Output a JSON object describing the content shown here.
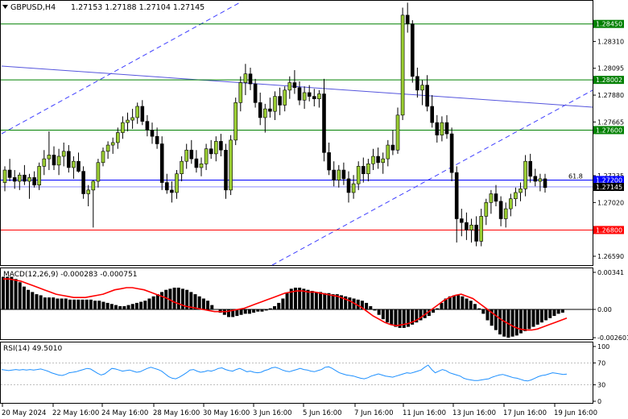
{
  "header": {
    "symbol": "GBPUSD,H4",
    "ohlc": "1.27153 1.27188 1.27104 1.27145",
    "triangle_icon": "triangle-down-icon"
  },
  "colors": {
    "bull": "#9acd32",
    "bear": "#000000",
    "green_line": "#008000",
    "blue_line": "#0000ff",
    "red_line": "#ff0000",
    "channel": "#4040ff",
    "trend": "#5555dd"
  },
  "price_axis": {
    "ticks": [
      "1.28310",
      "1.28095",
      "1.27880",
      "1.27665",
      "1.27235",
      "1.27020",
      "1.26590"
    ],
    "labels": [
      {
        "text": "1.28450",
        "value": 1.2845,
        "color": "#008000"
      },
      {
        "text": "1.28002",
        "value": 1.28002,
        "color": "#008000"
      },
      {
        "text": "1.27600",
        "value": 1.276,
        "color": "#008000"
      },
      {
        "text": "1.27200",
        "value": 1.272,
        "color": "#0000ff"
      },
      {
        "text": "1.27145",
        "value": 1.27145,
        "color": "#000000"
      },
      {
        "text": "1.26800",
        "value": 1.268,
        "color": "#ff0000"
      }
    ],
    "fib_label": "61.8"
  },
  "macd": {
    "label": "MACD(12,26,9) -0.000283 -0.000751",
    "ticks": [
      "0.00341",
      "0.00",
      "-0.002601"
    ],
    "hist": [
      0.003,
      0.003,
      0.003,
      0.0028,
      0.0025,
      0.0021,
      0.0018,
      0.0016,
      0.0014,
      0.0013,
      0.0011,
      0.0011,
      0.0011,
      0.001,
      0.001,
      0.001,
      0.0009,
      0.0009,
      0.0009,
      0.0009,
      0.0009,
      0.0009,
      0.0008,
      0.0008,
      0.0007,
      0.0006,
      0.0005,
      0.0004,
      0.0003,
      0.0003,
      0.0004,
      0.0005,
      0.0006,
      0.0007,
      0.0008,
      0.001,
      0.0012,
      0.0014,
      0.0016,
      0.0018,
      0.0019,
      0.002,
      0.002,
      0.0019,
      0.0018,
      0.0016,
      0.0014,
      0.0012,
      0.001,
      0.0008,
      0.0004,
      0.0,
      -0.0003,
      -0.0005,
      -0.0007,
      -0.0007,
      -0.0006,
      -0.0005,
      -0.0004,
      -0.0004,
      -0.0003,
      -0.0002,
      -0.0002,
      -0.0001,
      0.0001,
      0.0003,
      0.0006,
      0.001,
      0.0015,
      0.0019,
      0.002,
      0.002,
      0.0019,
      0.0018,
      0.0017,
      0.0016,
      0.0016,
      0.0015,
      0.0015,
      0.0014,
      0.0014,
      0.0013,
      0.0012,
      0.0011,
      0.001,
      0.0009,
      0.0008,
      0.0006,
      0.0003,
      -0.0001,
      -0.0005,
      -0.0009,
      -0.0012,
      -0.0014,
      -0.0016,
      -0.0017,
      -0.0017,
      -0.0016,
      -0.0014,
      -0.0012,
      -0.001,
      -0.0008,
      -0.0006,
      -0.0003,
      0.0001,
      0.0006,
      0.001,
      0.0012,
      0.0013,
      0.0013,
      0.0012,
      0.001,
      0.0008,
      0.0005,
      0.0001,
      -0.0004,
      -0.001,
      -0.0015,
      -0.0019,
      -0.0023,
      -0.0025,
      -0.0026,
      -0.0025,
      -0.0024,
      -0.0022,
      -0.002,
      -0.0018,
      -0.0016,
      -0.0014,
      -0.0012,
      -0.001,
      -0.0008,
      -0.0006,
      -0.0004,
      -0.0003
    ],
    "signal": [
      0.0028,
      0.0028,
      0.0027,
      0.0026,
      0.0024,
      0.0022,
      0.002,
      0.0018,
      0.0016,
      0.0014,
      0.0013,
      0.0012,
      0.0011,
      0.0011,
      0.0011,
      0.0012,
      0.0013,
      0.0014,
      0.0016,
      0.0018,
      0.0019,
      0.002,
      0.002,
      0.0019,
      0.0018,
      0.0016,
      0.0014,
      0.0012,
      0.001,
      0.0007,
      0.0005,
      0.0003,
      0.0002,
      0.0001,
      0.0,
      -0.0001,
      -0.0002,
      -0.0002,
      -0.0002,
      -0.0001,
      0.0,
      0.0001,
      0.0003,
      0.0005,
      0.0007,
      0.0009,
      0.0011,
      0.0013,
      0.0015,
      0.0016,
      0.0017,
      0.0017,
      0.0016,
      0.0016,
      0.0015,
      0.0014,
      0.0013,
      0.0012,
      0.001,
      0.0008,
      0.0005,
      0.0002,
      -0.0002,
      -0.0006,
      -0.0009,
      -0.0012,
      -0.0014,
      -0.0015,
      -0.0014,
      -0.0013,
      -0.0011,
      -0.0008,
      -0.0004,
      0.0,
      0.0004,
      0.0008,
      0.0011,
      0.0013,
      0.0014,
      0.0012,
      0.001,
      0.0006,
      0.0002,
      -0.0002,
      -0.0006,
      -0.001,
      -0.0013,
      -0.0016,
      -0.0018,
      -0.0019,
      -0.0019,
      -0.0018,
      -0.0016,
      -0.0014,
      -0.0012,
      -0.001,
      -0.0008
    ]
  },
  "rsi": {
    "label": "RSI(14) 49.5010",
    "ticks": [
      "100",
      "70",
      "30",
      "0"
    ],
    "values": [
      58,
      57,
      56,
      57,
      58,
      57,
      58,
      57,
      58,
      57,
      58,
      59,
      57,
      55,
      52,
      50,
      48,
      47,
      49,
      52,
      53,
      54,
      56,
      58,
      60,
      59,
      55,
      51,
      48,
      50,
      55,
      60,
      59,
      57,
      55,
      56,
      57,
      55,
      53,
      54,
      57,
      60,
      62,
      60,
      58,
      55,
      50,
      45,
      42,
      41,
      44,
      48,
      52,
      57,
      58,
      55,
      53,
      54,
      56,
      55,
      57,
      60,
      61,
      58,
      56,
      55,
      58,
      60,
      57,
      54,
      55,
      53,
      52,
      53,
      56,
      58,
      61,
      62,
      60,
      57,
      55,
      54,
      56,
      58,
      60,
      58,
      57,
      55,
      54,
      56,
      58,
      62,
      63,
      60,
      56,
      52,
      50,
      48,
      47,
      46,
      44,
      42,
      41,
      43,
      46,
      48,
      50,
      48,
      46,
      45,
      44,
      46,
      48,
      50,
      52,
      51,
      53,
      55,
      57,
      62,
      66,
      58,
      52,
      55,
      58,
      56,
      52,
      50,
      48,
      46,
      42,
      40,
      39,
      38,
      38,
      39,
      40,
      41,
      44,
      46,
      48,
      49,
      47,
      45,
      43,
      42,
      40,
      38,
      37,
      39,
      42,
      45,
      47,
      48,
      50,
      52,
      51,
      50,
      49,
      49.5
    ]
  },
  "time_axis": [
    "20 May 2024",
    "22 May 16:00",
    "24 May 16:00",
    "28 May 16:00",
    "30 May 16:00",
    "3 Jun 16:00",
    "5 Jun 16:00",
    "7 Jun 16:00",
    "11 Jun 16:00",
    "13 Jun 16:00",
    "17 Jun 16:00",
    "19 Jun 16:00"
  ],
  "candles": [
    [
      1.2718,
      1.2731,
      1.2711,
      1.2728
    ],
    [
      1.2728,
      1.2737,
      1.2719,
      1.2722
    ],
    [
      1.2722,
      1.2728,
      1.2713,
      1.2719
    ],
    [
      1.2719,
      1.2726,
      1.2712,
      1.2724
    ],
    [
      1.2724,
      1.2732,
      1.2716,
      1.2719
    ],
    [
      1.2719,
      1.2725,
      1.2705,
      1.2722
    ],
    [
      1.2722,
      1.2727,
      1.2714,
      1.2716
    ],
    [
      1.2716,
      1.2734,
      1.2712,
      1.2731
    ],
    [
      1.2731,
      1.2744,
      1.2724,
      1.2737
    ],
    [
      1.2737,
      1.2759,
      1.2728,
      1.274
    ],
    [
      1.274,
      1.2747,
      1.2728,
      1.2732
    ],
    [
      1.2732,
      1.2745,
      1.2724,
      1.2739
    ],
    [
      1.2739,
      1.275,
      1.2731,
      1.2743
    ],
    [
      1.2743,
      1.2748,
      1.2726,
      1.273
    ],
    [
      1.273,
      1.2739,
      1.2721,
      1.2735
    ],
    [
      1.2735,
      1.2742,
      1.2726,
      1.2727
    ],
    [
      1.2727,
      1.2731,
      1.2705,
      1.2709
    ],
    [
      1.2709,
      1.2716,
      1.2699,
      1.2712
    ],
    [
      1.2712,
      1.272,
      1.2682,
      1.2719
    ],
    [
      1.2719,
      1.2737,
      1.2714,
      1.2734
    ],
    [
      1.2734,
      1.2746,
      1.2731,
      1.2743
    ],
    [
      1.2743,
      1.2751,
      1.2737,
      1.2748
    ],
    [
      1.2748,
      1.2754,
      1.2741,
      1.275
    ],
    [
      1.275,
      1.2762,
      1.2745,
      1.2758
    ],
    [
      1.2758,
      1.2771,
      1.2753,
      1.2766
    ],
    [
      1.2766,
      1.2774,
      1.2759,
      1.2768
    ],
    [
      1.2768,
      1.2777,
      1.2761,
      1.277
    ],
    [
      1.277,
      1.2782,
      1.2765,
      1.2779
    ],
    [
      1.2779,
      1.2784,
      1.2764,
      1.2767
    ],
    [
      1.2767,
      1.2772,
      1.2755,
      1.276
    ],
    [
      1.276,
      1.2766,
      1.2749,
      1.2755
    ],
    [
      1.2755,
      1.2762,
      1.2745,
      1.2749
    ],
    [
      1.2749,
      1.2755,
      1.2712,
      1.2718
    ],
    [
      1.2718,
      1.2725,
      1.2709,
      1.2712
    ],
    [
      1.2712,
      1.2719,
      1.2702,
      1.271
    ],
    [
      1.271,
      1.2728,
      1.2705,
      1.2725
    ],
    [
      1.2725,
      1.2739,
      1.2719,
      1.2735
    ],
    [
      1.2735,
      1.2749,
      1.2729,
      1.2744
    ],
    [
      1.2744,
      1.2752,
      1.2733,
      1.2737
    ],
    [
      1.2737,
      1.2744,
      1.2726,
      1.273
    ],
    [
      1.273,
      1.2738,
      1.2723,
      1.2733
    ],
    [
      1.2733,
      1.2749,
      1.2728,
      1.2745
    ],
    [
      1.2745,
      1.2752,
      1.2737,
      1.2741
    ],
    [
      1.2741,
      1.2755,
      1.2735,
      1.2751
    ],
    [
      1.2751,
      1.2757,
      1.2739,
      1.2744
    ],
    [
      1.2744,
      1.2749,
      1.2705,
      1.2712
    ],
    [
      1.2712,
      1.2756,
      1.2708,
      1.2752
    ],
    [
      1.2752,
      1.2786,
      1.2748,
      1.2782
    ],
    [
      1.2782,
      1.2803,
      1.2775,
      1.2798
    ],
    [
      1.2798,
      1.2813,
      1.2788,
      1.2805
    ],
    [
      1.2805,
      1.281,
      1.2792,
      1.2797
    ],
    [
      1.2797,
      1.2801,
      1.2778,
      1.2782
    ],
    [
      1.2782,
      1.279,
      1.2764,
      1.277
    ],
    [
      1.277,
      1.2781,
      1.2758,
      1.2777
    ],
    [
      1.2777,
      1.2786,
      1.277,
      1.2775
    ],
    [
      1.2775,
      1.2791,
      1.2768,
      1.2787
    ],
    [
      1.2787,
      1.2794,
      1.2772,
      1.278
    ],
    [
      1.278,
      1.2795,
      1.2775,
      1.2792
    ],
    [
      1.2792,
      1.2803,
      1.2785,
      1.2798
    ],
    [
      1.2798,
      1.2808,
      1.2789,
      1.2794
    ],
    [
      1.2794,
      1.2799,
      1.278,
      1.2784
    ],
    [
      1.2784,
      1.2795,
      1.2777,
      1.279
    ],
    [
      1.279,
      1.2796,
      1.2783,
      1.2787
    ],
    [
      1.2787,
      1.2793,
      1.2779,
      1.2785
    ],
    [
      1.2785,
      1.2792,
      1.2778,
      1.2789
    ],
    [
      1.2789,
      1.2801,
      1.2735,
      1.2742
    ],
    [
      1.2742,
      1.275,
      1.2724,
      1.2728
    ],
    [
      1.2728,
      1.2735,
      1.2715,
      1.272
    ],
    [
      1.272,
      1.2732,
      1.2714,
      1.2728
    ],
    [
      1.2728,
      1.2734,
      1.2716,
      1.2721
    ],
    [
      1.2721,
      1.2727,
      1.2702,
      1.271
    ],
    [
      1.271,
      1.2724,
      1.2705,
      1.2717
    ],
    [
      1.2717,
      1.2735,
      1.2712,
      1.2731
    ],
    [
      1.2731,
      1.2738,
      1.2718,
      1.2725
    ],
    [
      1.2725,
      1.2737,
      1.2719,
      1.2733
    ],
    [
      1.2733,
      1.2745,
      1.2728,
      1.2739
    ],
    [
      1.2739,
      1.2746,
      1.2729,
      1.2734
    ],
    [
      1.2734,
      1.2742,
      1.2725,
      1.2737
    ],
    [
      1.2737,
      1.2752,
      1.2731,
      1.2748
    ],
    [
      1.2748,
      1.276,
      1.274,
      1.2744
    ],
    [
      1.2744,
      1.2778,
      1.2741,
      1.2772
    ],
    [
      1.2772,
      1.2858,
      1.2768,
      1.2852
    ],
    [
      1.2852,
      1.2862,
      1.2838,
      1.2845
    ],
    [
      1.2845,
      1.2848,
      1.2798,
      1.2803
    ],
    [
      1.2803,
      1.281,
      1.2786,
      1.2792
    ],
    [
      1.2792,
      1.28,
      1.278,
      1.2796
    ],
    [
      1.2796,
      1.2804,
      1.2775,
      1.2779
    ],
    [
      1.2779,
      1.2788,
      1.2762,
      1.2766
    ],
    [
      1.2766,
      1.2772,
      1.275,
      1.2756
    ],
    [
      1.2756,
      1.2771,
      1.2751,
      1.2766
    ],
    [
      1.2766,
      1.2772,
      1.2753,
      1.2757
    ],
    [
      1.2757,
      1.2762,
      1.2719,
      1.2726
    ],
    [
      1.2726,
      1.2731,
      1.267,
      1.2689
    ],
    [
      1.2689,
      1.2697,
      1.2675,
      1.2686
    ],
    [
      1.2686,
      1.2694,
      1.2672,
      1.268
    ],
    [
      1.268,
      1.2689,
      1.267,
      1.2684
    ],
    [
      1.2684,
      1.2691,
      1.2667,
      1.2671
    ],
    [
      1.2671,
      1.2697,
      1.2667,
      1.2691
    ],
    [
      1.2691,
      1.2705,
      1.2684,
      1.2702
    ],
    [
      1.2702,
      1.2712,
      1.2693,
      1.2709
    ],
    [
      1.2709,
      1.2716,
      1.2699,
      1.2703
    ],
    [
      1.2703,
      1.2707,
      1.2683,
      1.2689
    ],
    [
      1.2689,
      1.2702,
      1.2682,
      1.2697
    ],
    [
      1.2697,
      1.2709,
      1.2691,
      1.2705
    ],
    [
      1.2705,
      1.2714,
      1.2699,
      1.271
    ],
    [
      1.271,
      1.2718,
      1.2703,
      1.2713
    ],
    [
      1.2713,
      1.274,
      1.2707,
      1.2735
    ],
    [
      1.2735,
      1.2741,
      1.2718,
      1.2723
    ],
    [
      1.2723,
      1.2729,
      1.2715,
      1.2719
    ],
    [
      1.2719,
      1.2725,
      1.2711,
      1.2721
    ],
    [
      1.2721,
      1.2725,
      1.271,
      1.2714
    ]
  ]
}
